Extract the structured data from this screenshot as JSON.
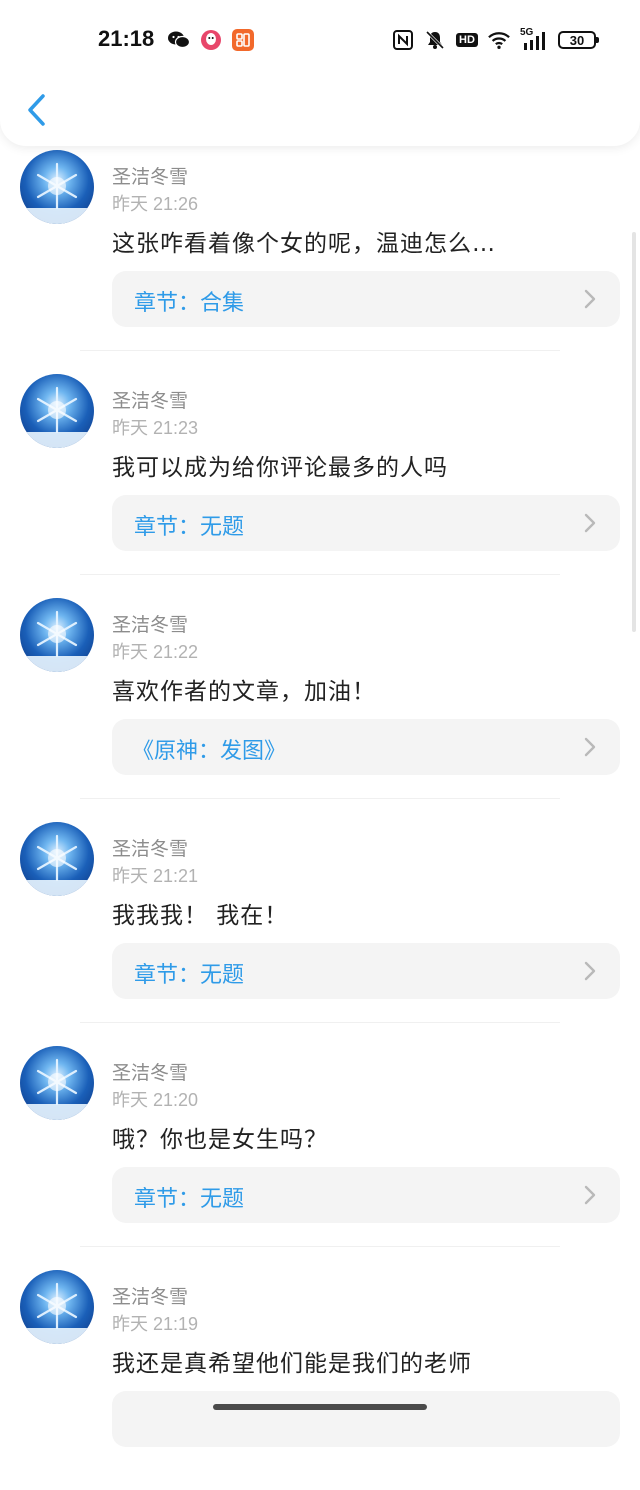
{
  "status_bar": {
    "time": "21:18",
    "left_icons": [
      "wechat-icon",
      "qq-icon",
      "app-icon"
    ],
    "right_icons": [
      "nfc-icon",
      "mute-icon",
      "hd-icon",
      "wifi-icon",
      "signal-5g-icon",
      "battery-icon"
    ],
    "hd_label": "HD",
    "network_label": "5G",
    "battery_level": "30"
  },
  "header": {
    "back_icon": "chevron-left-icon",
    "accent_color": "#2f9be8"
  },
  "comments": [
    {
      "user": "圣洁冬雪",
      "time": "昨天 21:26",
      "content": "这张咋看着像个女的呢，温迪怎么…",
      "chapter": "章节：合集"
    },
    {
      "user": "圣洁冬雪",
      "time": "昨天 21:23",
      "content": "我可以成为给你评论最多的人吗",
      "chapter": "章节：无题"
    },
    {
      "user": "圣洁冬雪",
      "time": "昨天 21:22",
      "content": "喜欢作者的文章，加油！",
      "chapter": "《原神：发图》"
    },
    {
      "user": "圣洁冬雪",
      "time": "昨天 21:21",
      "content": "我我我！ 我在！",
      "chapter": "章节：无题"
    },
    {
      "user": "圣洁冬雪",
      "time": "昨天 21:20",
      "content": "哦？你也是女生吗？",
      "chapter": "章节：无题"
    },
    {
      "user": "圣洁冬雪",
      "time": "昨天 21:19",
      "content": "我还是真希望他们能是我们的老师",
      "chapter": ""
    }
  ]
}
